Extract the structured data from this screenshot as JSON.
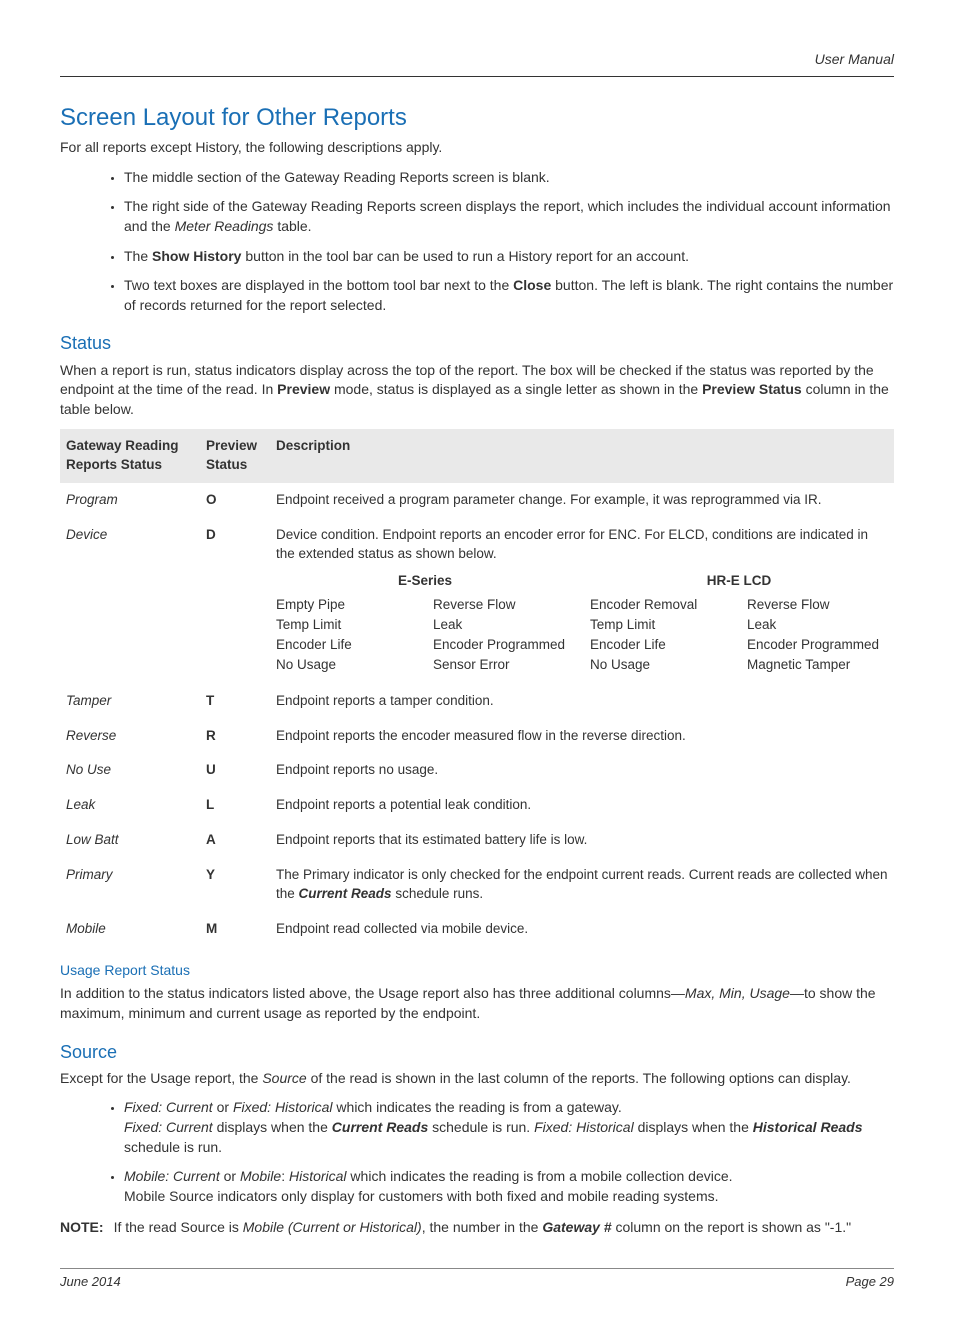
{
  "header": {
    "doc_title": "User Manual"
  },
  "h1": "Screen Layout for Other Reports",
  "intro": "For all reports except History, the following descriptions apply.",
  "bullets1": {
    "b0": "The middle section of the Gateway Reading Reports screen is blank.",
    "b1_a": "The right side of the Gateway Reading Reports screen displays the report, which includes the individual account information and the ",
    "b1_i": "Meter Readings",
    "b1_b": " table.",
    "b2_a": "The ",
    "b2_bold": "Show History",
    "b2_b": " button in the tool bar can be used to run a History report for an account.",
    "b3_a": "Two text boxes are displayed in the bottom tool bar next to the ",
    "b3_bold": "Close",
    "b3_b": " button. The left is blank. The right contains the number of records returned for the report selected."
  },
  "status": {
    "title": "Status",
    "p_a": "When a report is run, status indicators display across the top of the report. The box will be checked if the status was reported by the endpoint at the time of the read. In ",
    "p_bold1": "Preview",
    "p_b": " mode, status is displayed as a single letter as shown in the ",
    "p_bold2": "Preview Status",
    "p_c": " column in the table below."
  },
  "table": {
    "headers": {
      "c0": "Gateway Reading Reports Status",
      "c1": "Preview Status",
      "c2": "Description"
    },
    "rows": {
      "r0": {
        "c0": "Program",
        "c1": "O",
        "c2": "Endpoint received a program parameter change. For example, it was reprogrammed via IR."
      },
      "r1": {
        "c0": "Device",
        "c1": "D",
        "c2": "Device condition. Endpoint reports an encoder error for ENC. For ELCD, conditions are indicated in the extended status as shown below.",
        "sub": {
          "h0": "E-Series",
          "h1": "HR-E LCD",
          "a0": "Empty Pipe",
          "a1": "Temp Limit",
          "a2": "Encoder Life",
          "a3": "No Usage",
          "b0": "Reverse Flow",
          "b1": "Leak",
          "b2": "Encoder Programmed",
          "b3": "Sensor Error",
          "c0": "Encoder Removal",
          "c1": "Temp Limit",
          "c2": "Encoder Life",
          "c3": "No Usage",
          "d0": "Reverse Flow",
          "d1": "Leak",
          "d2": "Encoder Programmed",
          "d3": "Magnetic Tamper"
        }
      },
      "r2": {
        "c0": "Tamper",
        "c1": "T",
        "c2": "Endpoint reports a tamper condition."
      },
      "r3": {
        "c0": "Reverse",
        "c1": "R",
        "c2": "Endpoint reports the encoder measured flow in the reverse direction."
      },
      "r4": {
        "c0": "No Use",
        "c1": "U",
        "c2": "Endpoint reports no usage."
      },
      "r5": {
        "c0": "Leak",
        "c1": "L",
        "c2": "Endpoint reports a potential leak condition."
      },
      "r6": {
        "c0": "Low Batt",
        "c1": "A",
        "c2": "Endpoint reports that its estimated battery life is low."
      },
      "r7": {
        "c0": "Primary",
        "c1": "Y",
        "c2_a": "The Primary indicator is only checked for the endpoint current reads. Current reads are collected when the ",
        "c2_bi": "Current Reads",
        "c2_b": " schedule runs."
      },
      "r8": {
        "c0": "Mobile",
        "c1": "M",
        "c2": "Endpoint read collected via mobile device."
      }
    }
  },
  "usage": {
    "title": "Usage Report Status",
    "p_a": "In addition to the status indicators listed above, the Usage report also has three additional columns—",
    "p_i": "Max, Min, Usage",
    "p_b": "—to show the maximum, minimum and current usage as reported by the endpoint."
  },
  "source": {
    "title": "Source",
    "p_a": "Except for the Usage report, the ",
    "p_i": "Source",
    "p_b": " of the read is shown in the last column of the reports. The following options can display.",
    "b1": {
      "a": "Fixed: Current",
      "or": " or ",
      "b": "Fixed: Historical",
      "tail": " which indicates the reading is from a gateway.",
      "line2a": "Fixed: Current",
      "line2b": " displays when the ",
      "line2bi": "Current Reads",
      "line2c": " schedule is run. ",
      "line2d": "Fixed: Historical",
      "line2e": " displays when the ",
      "line2bi2": "Historical Reads",
      "line2f": " schedule is run."
    },
    "b2": {
      "a": "Mobile: Current",
      "or": " or ",
      "b": "Mobile",
      "colon": ": ",
      "c": "Historical",
      "tail": " which indicates the reading is from a mobile collection device.",
      "line2": "Mobile Source indicators only display for customers with both fixed and mobile reading systems."
    }
  },
  "note": {
    "label": "NOTE:",
    "a": "If the read Source is ",
    "i": "Mobile (Current or Historical)",
    "b": ", the number in the ",
    "bi": "Gateway #",
    "c": " column on the report is shown as \"-1.\""
  },
  "footer": {
    "date": "June 2014",
    "page": "Page 29"
  }
}
